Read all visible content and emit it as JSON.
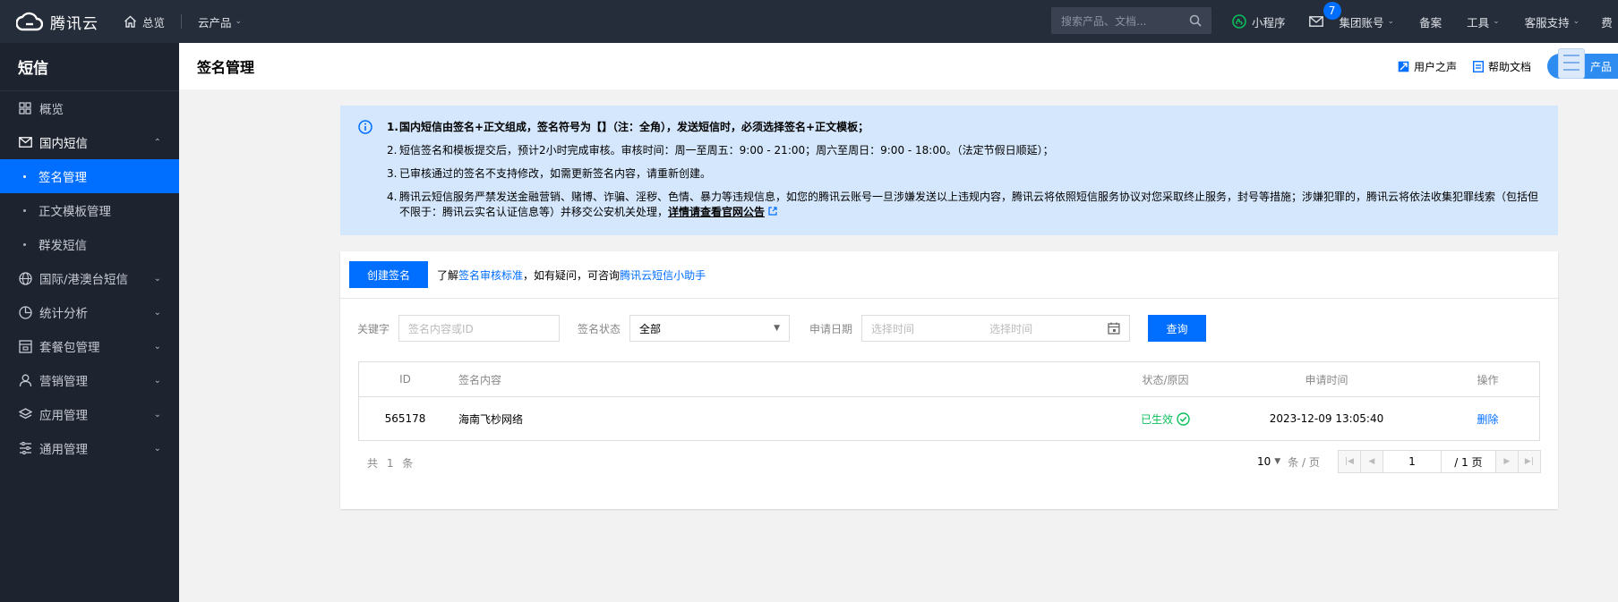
{
  "topbar": {
    "logo_text": "腾讯云",
    "home_label": "总览",
    "products_label": "云产品",
    "search_placeholder": "搜索产品、文档...",
    "miniapp_label": "小程序",
    "mail_badge": "7",
    "group_account_label": "集团账号",
    "beian_label": "备案",
    "tools_label": "工具",
    "support_label": "客服支持",
    "more_label": "费"
  },
  "sidebar": {
    "title": "短信",
    "items": [
      {
        "label": "概览",
        "icon": "grid-icon"
      },
      {
        "label": "国内短信",
        "icon": "mail-icon",
        "caret": "⌃"
      },
      {
        "label": "国际/港澳台短信",
        "icon": "globe-icon",
        "caret": "⌄"
      },
      {
        "label": "统计分析",
        "icon": "pie-chart-icon",
        "caret": "⌄"
      },
      {
        "label": "套餐包管理",
        "icon": "package-icon",
        "caret": "⌄"
      },
      {
        "label": "营销管理",
        "icon": "user-icon",
        "caret": "⌄"
      },
      {
        "label": "应用管理",
        "icon": "layers-icon",
        "caret": "⌄"
      },
      {
        "label": "通用管理",
        "icon": "sliders-icon",
        "caret": "⌄"
      }
    ],
    "sub_items": [
      {
        "label": "签名管理",
        "active": true
      },
      {
        "label": "正文模板管理",
        "active": false
      },
      {
        "label": "群发短信",
        "active": false
      }
    ]
  },
  "header": {
    "title": "签名管理",
    "user_voice": "用户之声",
    "help_docs": "帮助文档",
    "product_label": "产品"
  },
  "alert": {
    "lines": [
      {
        "num": "1.",
        "text": "国内短信由签名+正文组成，签名符号为【】（注：全角），发送短信时，必须选择签名+正文模板；"
      },
      {
        "num": "2.",
        "text": "短信签名和模板提交后，预计2小时完成审核。审核时间：周一至周五：9:00 - 21:00；周六至周日：9:00 - 18:00。（法定节假日顺延）；"
      },
      {
        "num": "3.",
        "text": "已审核通过的签名不支持修改，如需更新签名内容，请重新创建。"
      },
      {
        "num": "4.",
        "text": "腾讯云短信服务严禁发送金融营销、赌博、诈骗、淫秽、色情、暴力等违规信息，如您的腾讯云账号一旦涉嫌发送以上违规内容，腾讯云将依照短信服务协议对您采取终止服务，封号等措施；涉嫌犯罪的，腾讯云将依法收集犯罪线索（包括但不限于：腾讯云实名认证信息等）并移交公安机关处理，",
        "link": "详情请查看官网公告"
      }
    ]
  },
  "card": {
    "create_button": "创建签名",
    "tip_prefix": "了解",
    "tip_link1": "签名审核标准",
    "tip_middle": "，如有疑问，可咨询",
    "tip_link2": "腾讯云短信小助手",
    "filter": {
      "keyword_label": "关键字",
      "keyword_placeholder": "签名内容或ID",
      "status_label": "签名状态",
      "status_value": "全部",
      "date_label": "申请日期",
      "date_start_placeholder": "选择时间",
      "date_end_placeholder": "选择时间",
      "query_button": "查询"
    },
    "table": {
      "headers": {
        "id": "ID",
        "content": "签名内容",
        "status": "状态/原因",
        "time": "申请时间",
        "op": "操作"
      },
      "rows": [
        {
          "id": "565178",
          "content": "海南飞杪网络",
          "status": "已生效",
          "time": "2023-12-09 13:05:40",
          "op": "删除"
        }
      ]
    },
    "pager": {
      "total": "共 1 条",
      "page_size": "10",
      "page_size_unit": "条 / 页",
      "current_page": "1",
      "total_pages": "/ 1 页"
    }
  },
  "colors": {
    "topbar": "#262d3a",
    "sidebar": "#1e2330",
    "primary": "#006eff",
    "success": "#0abf5b",
    "alert_bg": "#d5e7fd"
  }
}
